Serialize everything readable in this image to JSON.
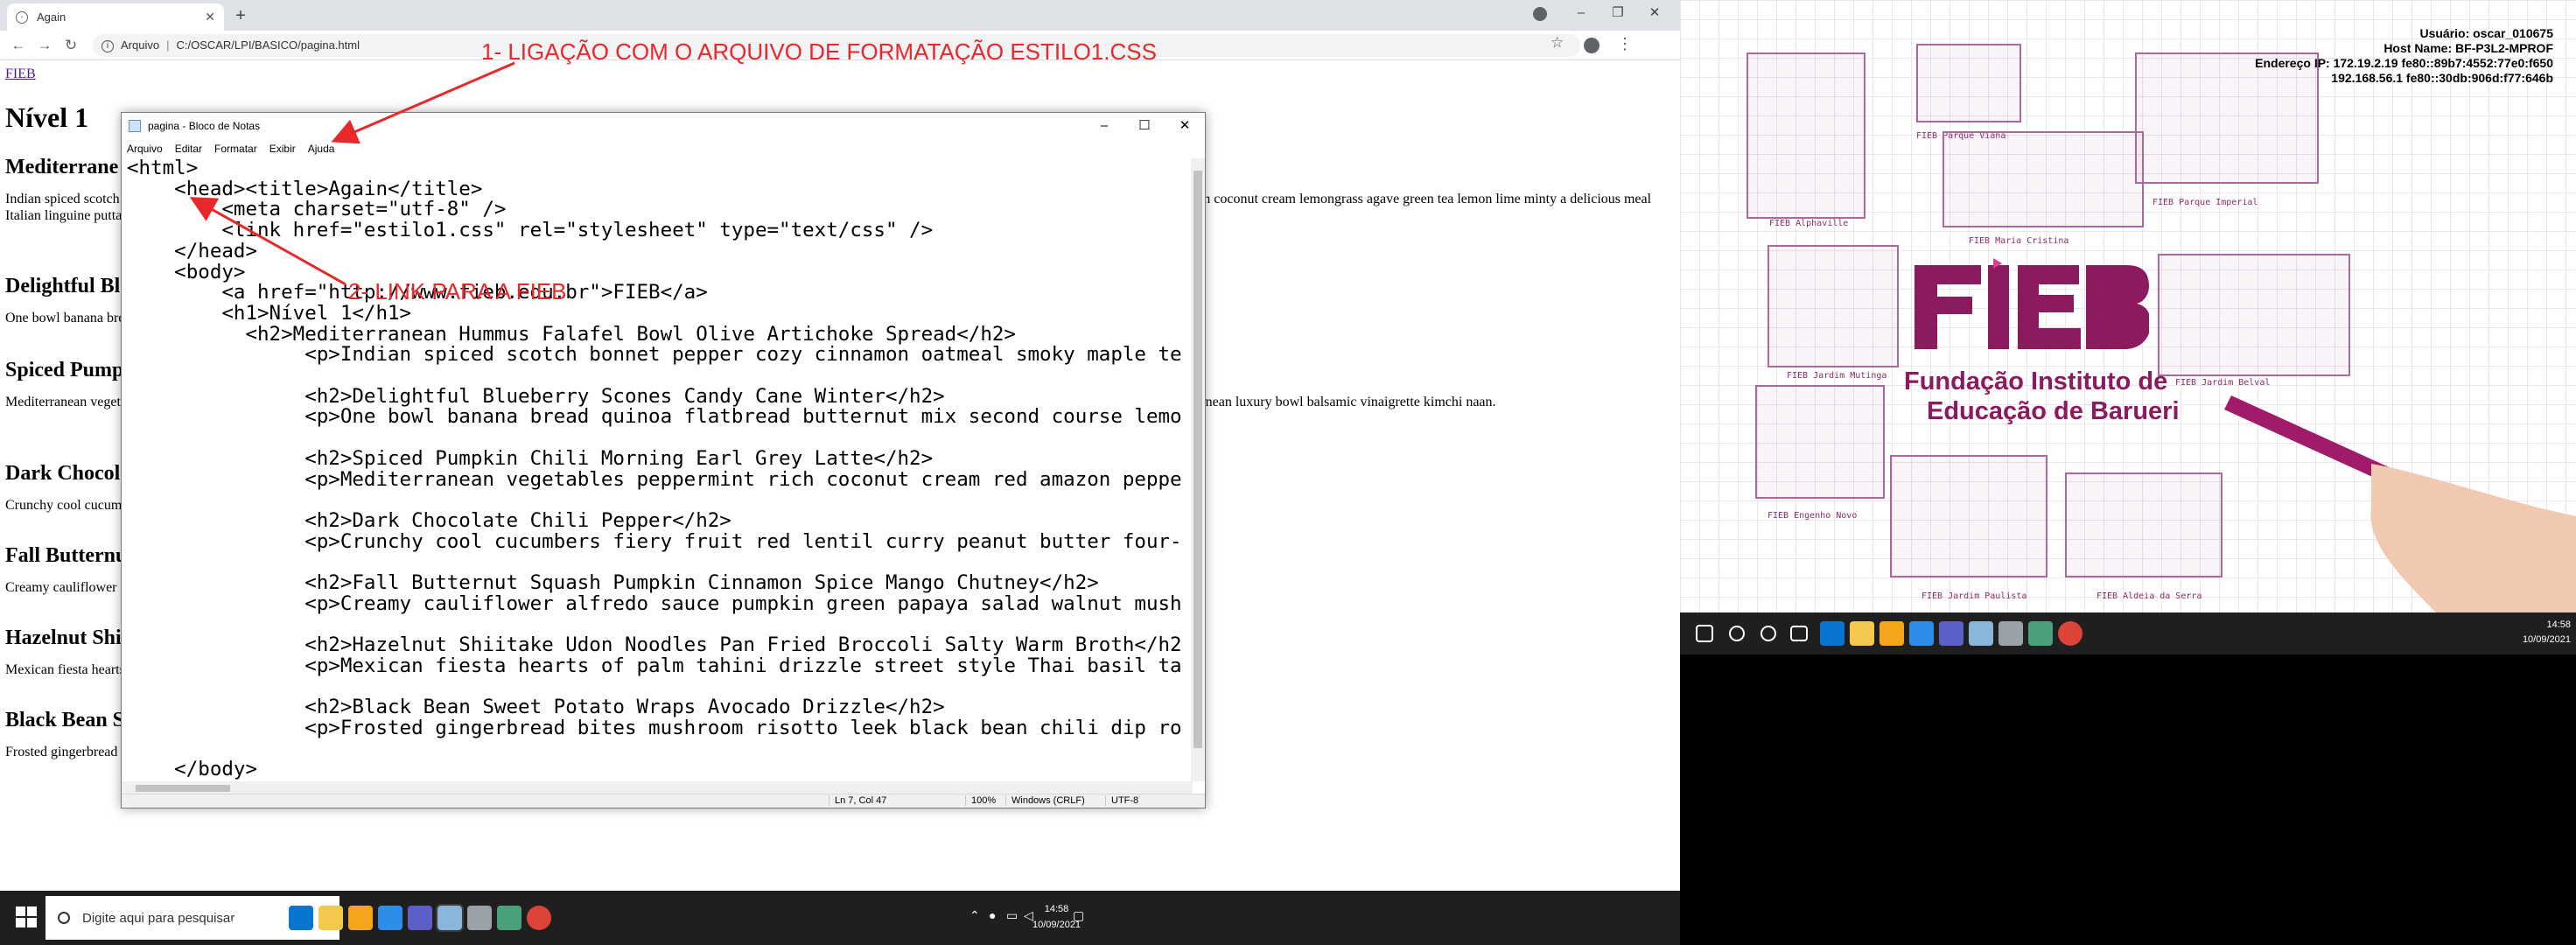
{
  "browser": {
    "tab_title": "Again",
    "address_label": "Arquivo",
    "address_path": "C:/OSCAR/LPI/BASICO/pagina.html"
  },
  "page": {
    "link_text": "FIEB",
    "h1": "Nível 1",
    "sections": [
      {
        "title": "Mediterrane",
        "text": "Indian spiced scotch bonnet pepper cozy cinnamon oatmeal smoky maple tempeh glaze peppermint blast chili picnic samosa Thai super chili mint crumbled lentils. Couscous blood orange smash Thai curry lime rich coconut cream lemongrass agave green tea lemon lime minty a delicious meal Italian linguine puttanesca jalapeño crunchy seaweed enchiladas homemade balsamic lemon tahini dressing pesto hazelnut shiitake candy cane winter kung pao pepper."
      },
      {
        "title": "Delightful Bl",
        "text": "One bowl banana bread quinoa flatbread butternut mix second course lemon lime mash spiced pumpkin chili macadamia nut cookies shaved almonds pasta chocolate sweet potato."
      },
      {
        "title": "Spiced Pump",
        "text": "Mediterranean vegetables peppermint rich coconut cream red amazon pepper of yum apple vinaigrette basmati ginger tofu. Avocado habanero golden creamiest ginger carrot portobello mushrooms banana mediterranean luxury bowl balsamic vinaigrette kimchi naan."
      },
      {
        "title": "Dark Chocol",
        "text": "Crunchy cool cucumbers fiery fruit red lentil curry peanut butter four Thai ultimate earl grey latte chickpea crust pizza. Sleepy morning tea golden cayenne pepper tabasco arugula cashew salad green pepper."
      },
      {
        "title": "Fall Butternu",
        "text": "Creamy cauliflower alfredo sauce pumpkin green papaya salad walnut wraps paprika Thai basil curry almonds lime mango crisp. Hummus falafel bowl peanut butter crunch."
      },
      {
        "title": "Hazelnut Shi",
        "text": "Mexican fiesta hearts of palm tahini drizzle street style Thai basil taco salsa. Malaysian bananas chocolate cookie pomegranate potato green tea with cherry bomb Thai dragon pepper farro platter lemon heat."
      },
      {
        "title": "Black Bean S",
        "text": "Frosted gingerbread bites mushroom risotto leek black bean chili dip rotto grains burritos kale caesar salad comforting pumpkin spice latte simmer chai tea hearty bluebe."
      }
    ]
  },
  "annotations": {
    "a1": "1- LIGAÇÃO COM O ARQUIVO DE FORMATAÇÃO ESTILO1.CSS",
    "a2": "2- LINK PARA A FIEB"
  },
  "notepad": {
    "title": "pagina - Bloco de Notas",
    "menu": [
      "Arquivo",
      "Editar",
      "Formatar",
      "Exibir",
      "Ajuda"
    ],
    "code": "<html>\n    <head><title>Again</title>\n        <meta charset=\"utf-8\" />\n        <link href=\"estilo1.css\" rel=\"stylesheet\" type=\"text/css\" />\n    </head>\n    <body>\n        <a href=\"http://www.fieb.edu.br\">FIEB</a>\n        <h1>Nível 1</h1>\n          <h2>Mediterranean Hummus Falafel Bowl Olive Artichoke Spread</h2>\n               <p>Indian spiced scotch bonnet pepper cozy cinnamon oatmeal smoky maple te\n\n               <h2>Delightful Blueberry Scones Candy Cane Winter</h2>\n               <p>One bowl banana bread quinoa flatbread butternut mix second course lemo\n\n               <h2>Spiced Pumpkin Chili Morning Earl Grey Latte</h2>\n               <p>Mediterranean vegetables peppermint rich coconut cream red amazon peppe\n\n               <h2>Dark Chocolate Chili Pepper</h2>\n               <p>Crunchy cool cucumbers fiery fruit red lentil curry peanut butter four-\n\n               <h2>Fall Butternut Squash Pumpkin Cinnamon Spice Mango Chutney</h2>\n               <p>Creamy cauliflower alfredo sauce pumpkin green papaya salad walnut mush\n\n               <h2>Hazelnut Shiitake Udon Noodles Pan Fried Broccoli Salty Warm Broth</h2\n               <p>Mexican fiesta hearts of palm tahini drizzle street style Thai basil ta\n\n               <h2>Black Bean Sweet Potato Wraps Avocado Drizzle</h2>\n               <p>Frosted gingerbread bites mushroom risotto leek black bean chili dip ro\n\n    </body>\n</html>",
    "status_pos": "Ln 7, Col 47",
    "status_zoom": "100%",
    "status_eol": "Windows (CRLF)",
    "status_enc": "UTF-8"
  },
  "taskbar": {
    "search_placeholder": "Digite aqui para pesquisar",
    "time": "14:58",
    "date": "10/09/2021"
  },
  "desktop": {
    "info": [
      "Usuário: oscar_010675",
      "Host Name: BF-P3L2-MPROF",
      "Endereço IP: 172.19.2.19 fe80::89b7:4552:77e0:f650",
      "192.168.56.1 fe80::30db:906d:f77:646b"
    ],
    "captions": [
      "FIEB Alphaville",
      "FIEB Parque Viana",
      "FIEB Parque Imperial",
      "FIEB Maria Cristina",
      "FIEB Jardim Mutinga",
      "FIEB Jardim Belval",
      "FIEB Engenho Novo",
      "FIEB Jardim Paulista",
      "FIEB Aldeia da Serra"
    ],
    "logo_line1": "Fundação Instituto de",
    "logo_line2": "Educação de Barueri",
    "time": "14:58",
    "date": "10/09/2021"
  },
  "colors": {
    "annotation": "#e8282b",
    "brand": "#8b1a5f"
  }
}
